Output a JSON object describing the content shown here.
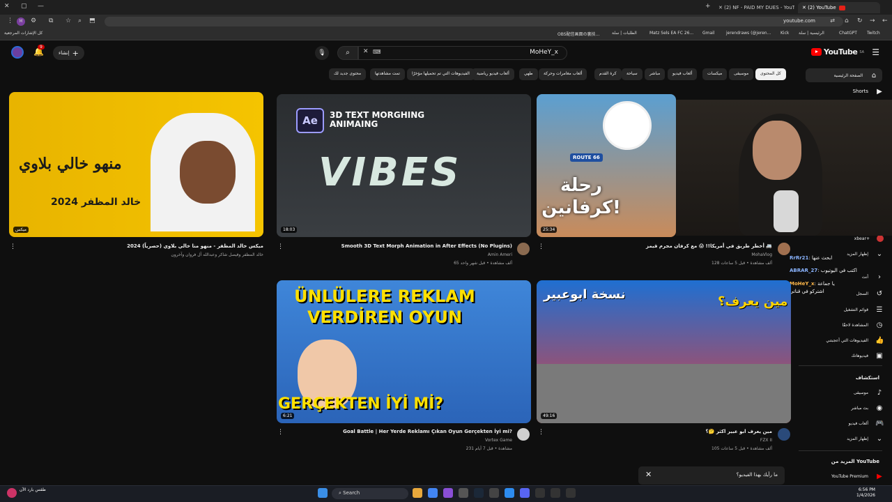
{
  "browser": {
    "tabs": [
      {
        "title": "(2) NF - PAID MY DUES - YouT..."
      },
      {
        "title": "(2) YouTube"
      }
    ],
    "url": "youtube.com",
    "bookmarks": [
      "كل الإشارات المرجعية",
      "OBS配信画面の裏技...",
      "الطلبات | سلة",
      "Matz Sels EA FC 26...",
      "Gmail",
      "jerendraws (@jeren...",
      "Kick",
      "الرئيسية | سلة",
      "ChatGPT",
      "Twitch"
    ]
  },
  "header": {
    "logo_text": "YouTube",
    "logo_region": "SA",
    "search_query": "MoHeY_x",
    "create_label": "إنشاء",
    "notif_count": "9"
  },
  "chips": [
    "كل المحتوى",
    "موسيقى",
    "ميكسات",
    "ألعاب فيديو",
    "مباشر",
    "سياحة",
    "كرة القدم",
    "ألعاب مغامرات وحركة",
    "طهي",
    "ألعاب فيديو رياضية",
    "الفيديوهات التي تم تحميلها مؤخرًا",
    "تمت مشاهدتها",
    "محتوى جديد لك"
  ],
  "sidebar": {
    "items": [
      {
        "label": "الصفحة الرئيسية",
        "icon": "home-icon"
      },
      {
        "label": "Shorts",
        "icon": "shorts-icon"
      },
      {
        "label": "xbear+",
        "icon": "subscriptions-icon"
      },
      {
        "label": "إظهار المزيد",
        "icon": "chevron-down-icon"
      },
      {
        "label": "أنت",
        "icon": "user-icon"
      },
      {
        "label": "السجل",
        "icon": "history-icon"
      },
      {
        "label": "قوائم التشغيل",
        "icon": "playlist-icon"
      },
      {
        "label": "المشاهدة لاحقًا",
        "icon": "clock-icon"
      },
      {
        "label": "الفيديوهات التي أعجبتني",
        "icon": "like-icon"
      },
      {
        "label": "فيديوهاتك",
        "icon": "video-icon"
      }
    ],
    "explore_title": "استكشاف",
    "explore": [
      {
        "label": "موسيقى",
        "icon": "music-icon"
      },
      {
        "label": "بث مباشر",
        "icon": "live-icon"
      },
      {
        "label": "ألعاب فيديو",
        "icon": "gaming-icon"
      },
      {
        "label": "إظهار المزيد",
        "icon": "chevron-down-icon"
      }
    ],
    "more_title": "المزيد من YouTube",
    "premium": "YouTube Premium"
  },
  "videos": [
    {
      "title": "ميكس خالد المظفر - منهو منا خالي بلاوي (حصرياً) 2024",
      "channel": "خالد المظفر وفيصل شاكر وعبدالله آل فروان وآخرون",
      "meta": "",
      "badge": "ميكس",
      "thumb_text": "منهو خالي بلاوي",
      "thumb_sub": "خالد المظفر 2024",
      "colors": [
        "#e8b400",
        "#f5c400"
      ]
    },
    {
      "title": "Smooth 3D Text Morph Animation in After Effects (No Plugins)",
      "channel": "Amin Ameri",
      "meta": "65 ألف مشاهدة • قبل شهر واحد",
      "duration": "18:03",
      "thumb_text": "VIBES",
      "thumb_sub": "3D TEXT MORGHING ANIMAING",
      "colors": [
        "#2a2d30",
        "#3a3e42"
      ]
    },
    {
      "title": "أخطر طريق في أمريكا!! 😱 مع كرفان مجرم قيمز 🚐",
      "channel": "MohaVlog",
      "meta": "128 ألف مشاهدة • قبل 5 ساعات",
      "duration": "25:34",
      "thumb_text": "رحلة كرفانين!",
      "thumb_sub": "ROUTE 66",
      "colors": [
        "#5b9fd1",
        "#c98b5a"
      ]
    },
    {
      "title": "Goal Battle | Her Yerde Reklamı Çıkan Oyun Gerçekten İyi mi?",
      "channel": "Vortex Game",
      "meta": "231 مشاهدة • قبل 7 أيام",
      "duration": "6:21",
      "thumb_text": "ÜNLÜLERE REKLAM VERDİREN OYUN",
      "thumb_sub": "GERÇEKTEN İYİ Mİ?",
      "colors": [
        "#3f86d9",
        "#2b64b8"
      ]
    },
    {
      "title": "مين يعرف ابو عبير اكثر 🤔؟",
      "channel": "FZX II",
      "meta": "105 ألف مشاهدة • قبل 5 ساعات",
      "duration": "49:16",
      "thumb_text": "مين يعرف؟",
      "thumb_sub": "نسخة ابوعبير",
      "colors": [
        "#1f6fd1",
        "#d94040"
      ]
    }
  ],
  "chat": [
    {
      "user": "RrRr21",
      "msg": "ابحث عنها"
    },
    {
      "user": "ABRAR_27",
      "msg": "اكتب في اليوتيوب"
    },
    {
      "user": "MoHeY_x",
      "msg": "يا جماعة اشتركو في قناتي"
    }
  ],
  "toast": "ما رأيك بهذا الفيديو؟",
  "taskbar": {
    "search": "Search",
    "time": "6:56 PM",
    "date": "1/4/2026",
    "weather": "طقس بارد الآن"
  }
}
